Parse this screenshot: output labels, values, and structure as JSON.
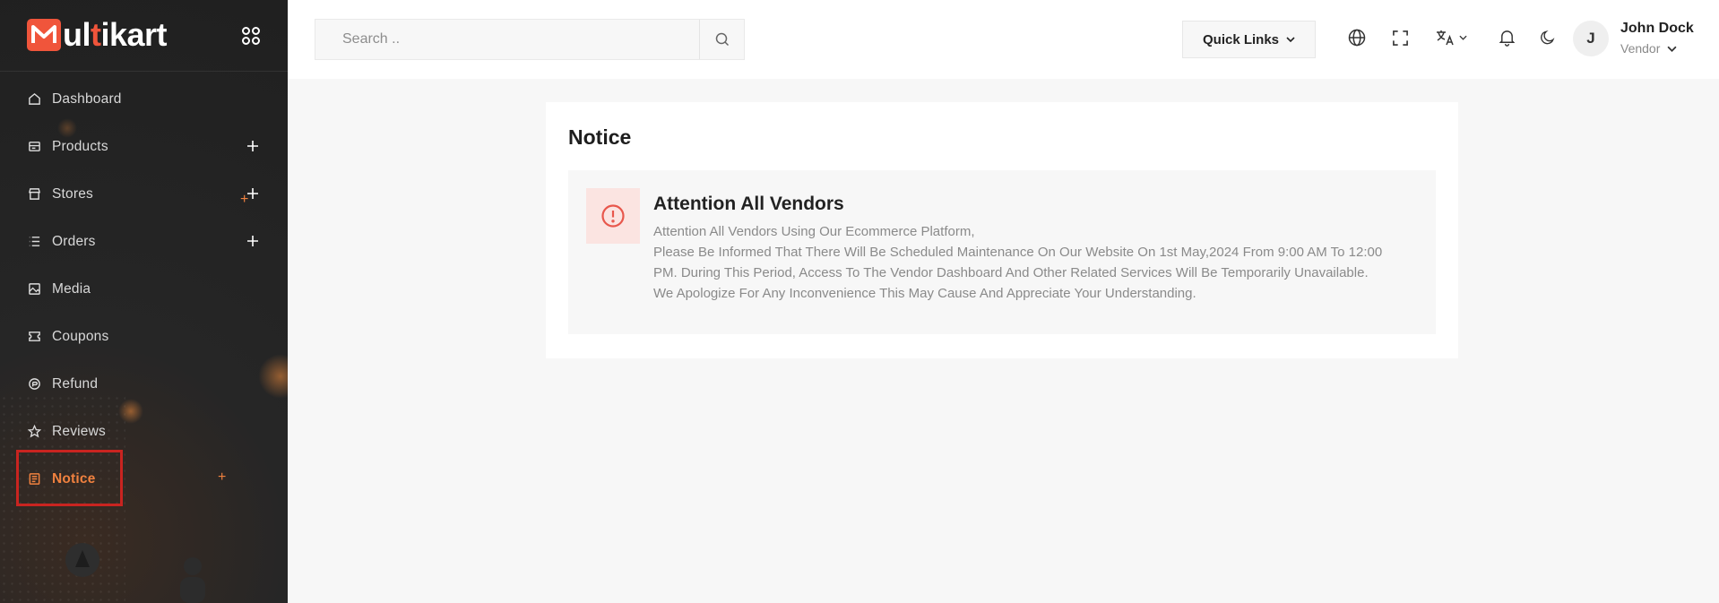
{
  "app": {
    "logo_text_prefix": "ul",
    "logo_text_i": "t",
    "logo_text_suffix": "ikart",
    "brand_color": "#f0553b",
    "accent_color": "#f0813f"
  },
  "sidebar": {
    "items": [
      {
        "label": "Dashboard",
        "icon": "home-icon",
        "expandable": false
      },
      {
        "label": "Products",
        "icon": "products-icon",
        "expandable": true
      },
      {
        "label": "Stores",
        "icon": "store-icon",
        "expandable": true
      },
      {
        "label": "Orders",
        "icon": "list-icon",
        "expandable": true
      },
      {
        "label": "Media",
        "icon": "image-icon",
        "expandable": false
      },
      {
        "label": "Coupons",
        "icon": "ticket-icon",
        "expandable": false
      },
      {
        "label": "Refund",
        "icon": "refund-icon",
        "expandable": false
      },
      {
        "label": "Reviews",
        "icon": "star-icon",
        "expandable": false
      },
      {
        "label": "Notice",
        "icon": "notice-icon",
        "expandable": false,
        "active": true
      }
    ]
  },
  "header": {
    "search_placeholder": "Search ..",
    "quick_links_label": "Quick Links",
    "user": {
      "initial": "J",
      "name": "John Dock",
      "role": "Vendor"
    }
  },
  "main": {
    "title": "Notice",
    "notice": {
      "heading": "Attention All Vendors",
      "lines": [
        "Attention All Vendors Using Our Ecommerce Platform,",
        "Please Be Informed That There Will Be Scheduled Maintenance On Our Website On 1st May,2024 From 9:00 AM To 12:00 PM. During This Period, Access To The Vendor Dashboard And Other Related Services Will Be Temporarily Unavailable.",
        "We Apologize For Any Inconvenience This May Cause And Appreciate Your Understanding."
      ],
      "icon": "alert-circle-icon",
      "icon_color": "#e8574c"
    }
  }
}
